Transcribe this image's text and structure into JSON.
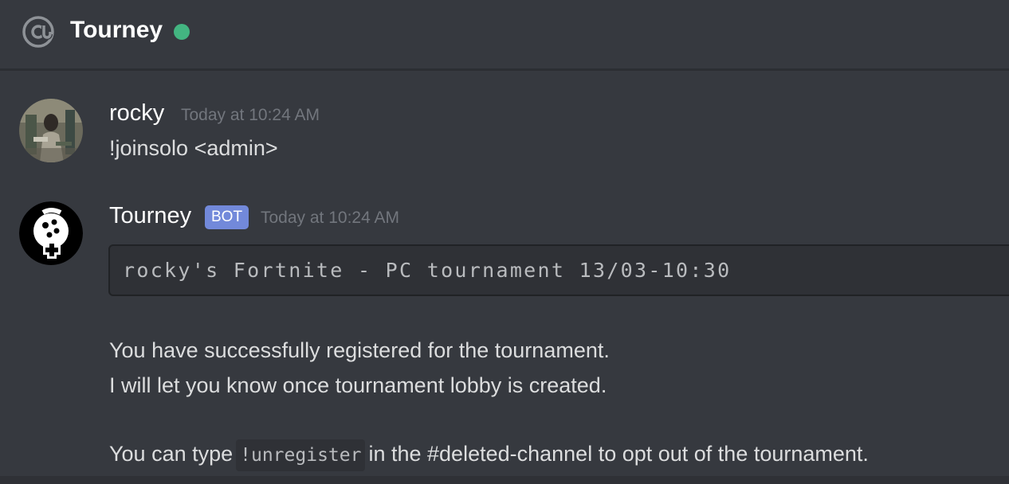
{
  "header": {
    "channel_icon": "at-icon",
    "title": "Tourney",
    "status": "online",
    "status_color": "#43b581"
  },
  "messages": [
    {
      "username": "rocky",
      "timestamp": "Today at 10:24 AM",
      "lines": [
        "!joinsolo <admin>"
      ]
    },
    {
      "username": "Tourney",
      "badge": "BOT",
      "timestamp": "Today at 10:24 AM",
      "codeblock": "rocky's Fortnite - PC tournament 13/03-10:30",
      "lines": [
        "You have successfully registered for the tournament.",
        "I will let you know once tournament lobby is created."
      ],
      "last_line": {
        "before": "You can type",
        "code": "!unregister",
        "after": "in the #deleted-channel to opt out of the tournament."
      }
    }
  ],
  "colors": {
    "background": "#36393f",
    "bot_badge": "#7289da",
    "username": "#ffffff",
    "timestamp": "#72767d"
  }
}
